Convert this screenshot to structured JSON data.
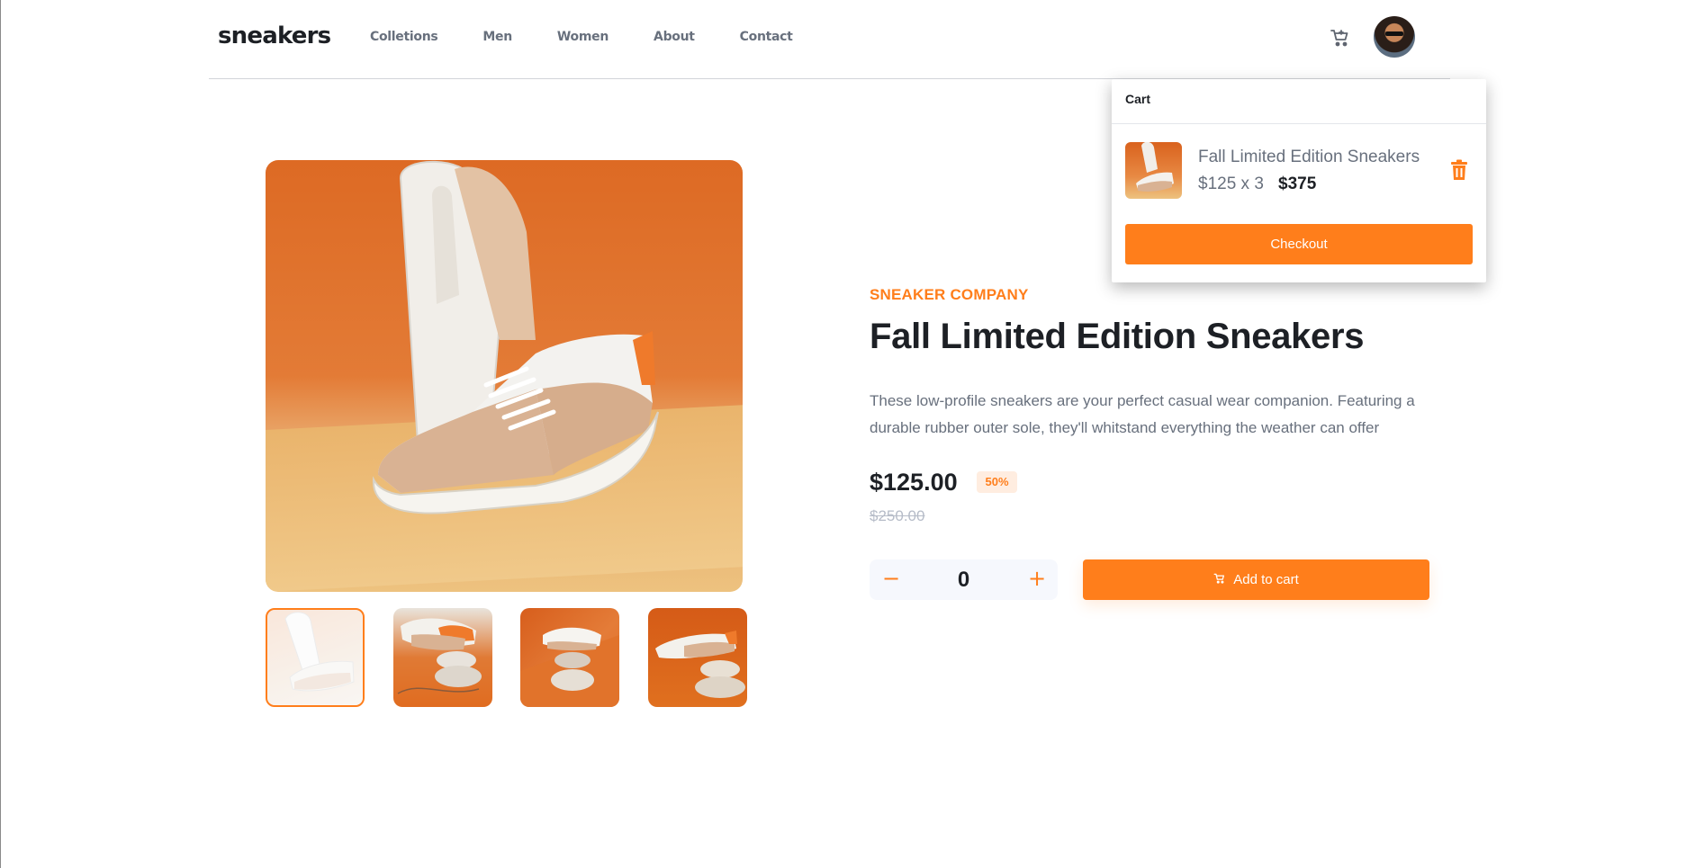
{
  "header": {
    "logo": "sneakers",
    "nav": [
      "Colletions",
      "Men",
      "Women",
      "About",
      "Contact"
    ],
    "cart_icon": "cart-icon",
    "avatar_icon": "avatar"
  },
  "cart": {
    "title": "Cart",
    "item": {
      "name": "Fall Limited Edition Sneakers",
      "calc": "$125 x 3",
      "total": "$375"
    },
    "delete_icon": "trash-icon",
    "checkout_label": "Checkout"
  },
  "product": {
    "company": "SNEAKER COMPANY",
    "title": "Fall Limited Edition Sneakers",
    "description": "These low-profile sneakers are your perfect casual wear companion. Featuring a durable rubber outer sole, they'll whitstand everything the weather can offer",
    "price": "$125.00",
    "discount": "50%",
    "old_price": "$250.00",
    "quantity": "0",
    "minus_label": "−",
    "plus_label": "+",
    "add_to_cart_label": "Add to cart"
  },
  "gallery": {
    "thumbnail_count": 4,
    "active_thumbnail": 1
  },
  "colors": {
    "accent": "#ff7e1b",
    "accent_pale": "#ffede0",
    "text_dark": "#1d2025",
    "text_grey": "#68707d"
  }
}
